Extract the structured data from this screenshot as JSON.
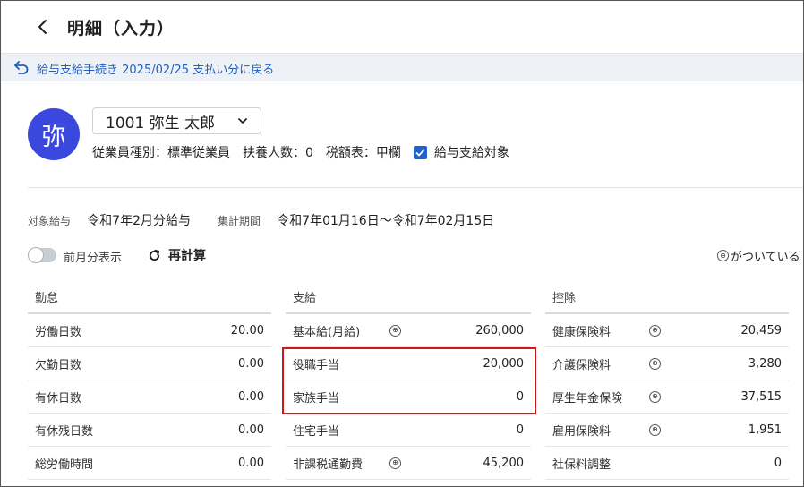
{
  "header": {
    "title": "明細（入力）"
  },
  "return_link": "給与支給手続き 2025/02/25 支払い分に戻る",
  "employee": {
    "avatar_char": "弥",
    "selected": "1001 弥生 太郎",
    "type": "従業員種別：標準従業員",
    "dependents": "扶養人数：0",
    "tax_table": "税額表：甲欄",
    "payroll_target": "給与支給対象"
  },
  "period": {
    "target_label": "対象給与",
    "target_value": "令和7年2月分給与",
    "range_label": "集計期間",
    "range_value": "令和7年01月16日〜令和7年02月15日"
  },
  "controls": {
    "prev_month_label": "前月分表示",
    "recalc_label": "再計算",
    "legend_text": "がついている"
  },
  "attendance": {
    "title": "勤怠",
    "rows": [
      {
        "name": "労働日数",
        "value": "20.00"
      },
      {
        "name": "欠勤日数",
        "value": "0.00"
      },
      {
        "name": "有休日数",
        "value": "0.00"
      },
      {
        "name": "有休残日数",
        "value": "0.00"
      },
      {
        "name": "総労働時間",
        "value": "0.00"
      }
    ]
  },
  "payments": {
    "title": "支給",
    "rows": [
      {
        "name": "基本給(月給)",
        "value": "260,000",
        "icon": true
      },
      {
        "name": "役職手当",
        "value": "20,000",
        "icon": false
      },
      {
        "name": "家族手当",
        "value": "0",
        "icon": false
      },
      {
        "name": "住宅手当",
        "value": "0",
        "icon": false
      },
      {
        "name": "非課税通勤費",
        "value": "45,200",
        "icon": true
      }
    ]
  },
  "deductions": {
    "title": "控除",
    "rows": [
      {
        "name": "健康保険料",
        "value": "20,459",
        "icon": true
      },
      {
        "name": "介護保険料",
        "value": "3,280",
        "icon": true
      },
      {
        "name": "厚生年金保険",
        "value": "37,515",
        "icon": true
      },
      {
        "name": "雇用保険料",
        "value": "1,951",
        "icon": true
      },
      {
        "name": "社保料調整",
        "value": "0",
        "icon": false
      }
    ]
  },
  "colors": {
    "avatar": "#3b48dd",
    "link": "#1f5fbf",
    "highlight": "#cc1a1a"
  }
}
